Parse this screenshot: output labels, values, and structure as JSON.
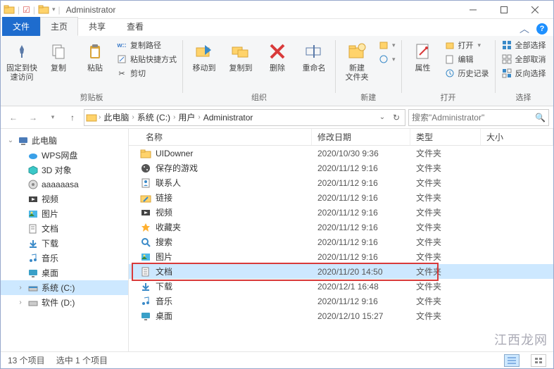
{
  "title": "Administrator",
  "tabs": {
    "file": "文件",
    "home": "主页",
    "share": "共享",
    "view": "查看"
  },
  "ribbon": {
    "pin": "固定到快\n速访问",
    "copy": "复制",
    "paste": "粘贴",
    "copy_path": "复制路径",
    "paste_shortcut": "粘贴快捷方式",
    "cut": "剪切",
    "group_clipboard": "剪贴板",
    "move_to": "移动到",
    "copy_to": "复制到",
    "delete": "删除",
    "rename": "重命名",
    "group_organize": "组织",
    "new_folder": "新建\n文件夹",
    "group_new": "新建",
    "properties": "属性",
    "open": "打开",
    "edit": "编辑",
    "history": "历史记录",
    "group_open": "打开",
    "select_all": "全部选择",
    "select_none": "全部取消",
    "invert": "反向选择",
    "group_select": "选择"
  },
  "breadcrumbs": [
    "此电脑",
    "系统 (C:)",
    "用户",
    "Administrator"
  ],
  "search_placeholder": "搜索\"Administrator\"",
  "nav": {
    "this_pc": "此电脑",
    "wps": "WPS网盘",
    "objects3d": "3D 对象",
    "aaaa": "aaaaaasa",
    "videos": "视频",
    "pictures": "图片",
    "documents": "文档",
    "downloads": "下载",
    "music": "音乐",
    "desktop": "桌面",
    "cdrive": "系统 (C:)",
    "ddrive": "软件 (D:)"
  },
  "columns": {
    "name": "名称",
    "date": "修改日期",
    "type": "类型",
    "size": "大小"
  },
  "type_folder": "文件夹",
  "files": [
    {
      "name": "UIDowner",
      "date": "2020/10/30 9:36",
      "icon": "folder"
    },
    {
      "name": "保存的游戏",
      "date": "2020/11/12 9:16",
      "icon": "games"
    },
    {
      "name": "联系人",
      "date": "2020/11/12 9:16",
      "icon": "contacts"
    },
    {
      "name": "链接",
      "date": "2020/11/12 9:16",
      "icon": "links"
    },
    {
      "name": "视频",
      "date": "2020/11/12 9:16",
      "icon": "video"
    },
    {
      "name": "收藏夹",
      "date": "2020/11/12 9:16",
      "icon": "favorites"
    },
    {
      "name": "搜索",
      "date": "2020/11/12 9:16",
      "icon": "search"
    },
    {
      "name": "图片",
      "date": "2020/11/12 9:16",
      "icon": "pictures"
    },
    {
      "name": "文档",
      "date": "2020/11/20 14:50",
      "icon": "documents",
      "selected": true
    },
    {
      "name": "下载",
      "date": "2020/12/1 16:48",
      "icon": "downloads"
    },
    {
      "name": "音乐",
      "date": "2020/11/12 9:16",
      "icon": "music"
    },
    {
      "name": "桌面",
      "date": "2020/12/10 15:27",
      "icon": "desktop"
    }
  ],
  "status": {
    "count": "13 个项目",
    "selected": "选中 1 个项目"
  },
  "watermark": "江西龙网"
}
